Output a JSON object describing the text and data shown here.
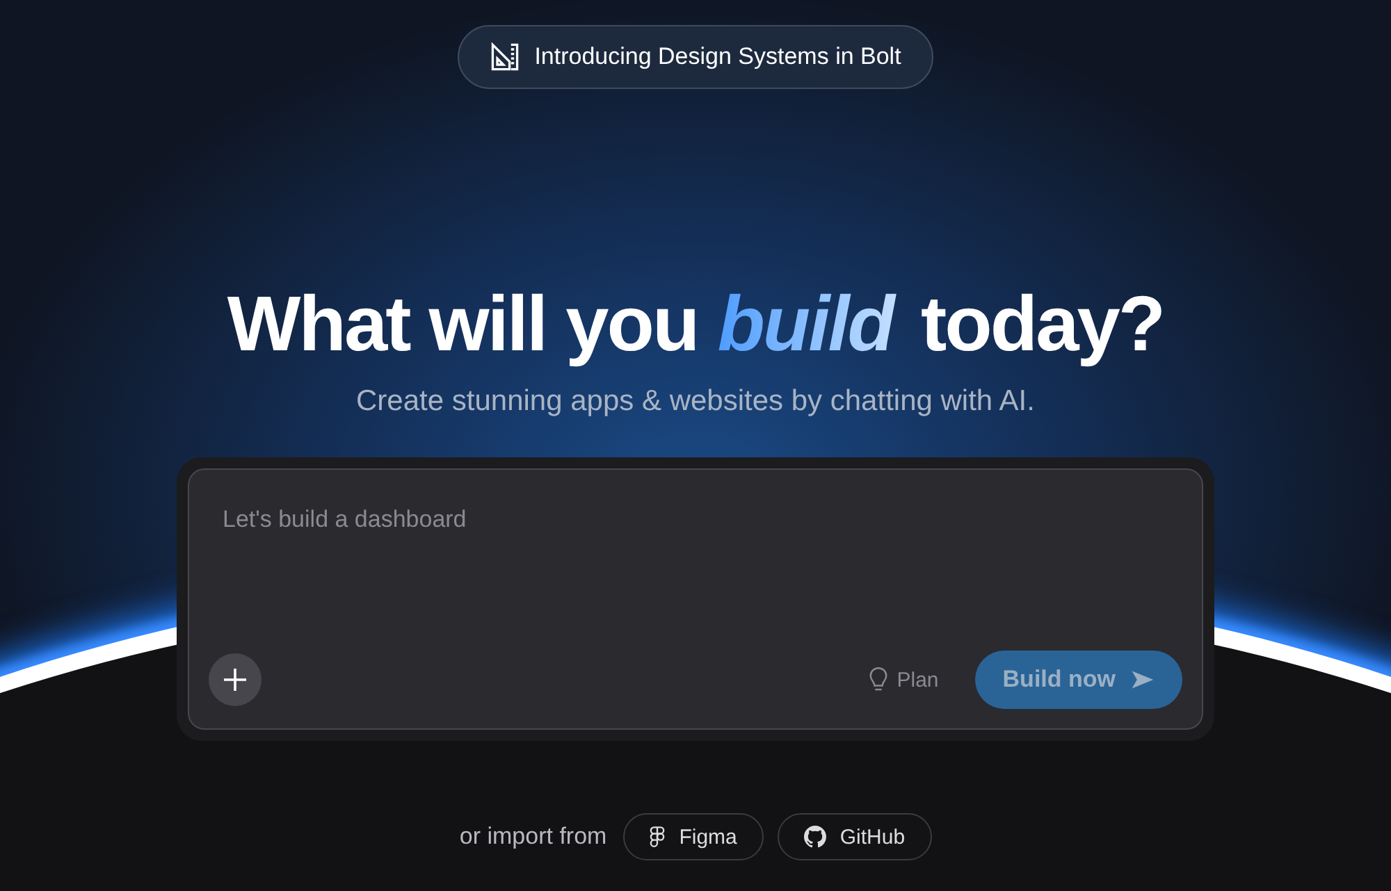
{
  "announcement": {
    "label": "Introducing Design Systems in Bolt"
  },
  "headline": {
    "before": "What will you",
    "highlight": "build",
    "after": "today?"
  },
  "subtitle": "Create stunning apps & websites by chatting with AI.",
  "prompt": {
    "placeholder": "Let's build a dashboard",
    "plan_label": "Plan",
    "submit": {
      "label": "Build now",
      "disabled": true
    }
  },
  "import": {
    "label": "or import from",
    "sources": [
      {
        "kind": "figma",
        "label": "Figma"
      },
      {
        "kind": "github",
        "label": "GitHub"
      }
    ]
  }
}
